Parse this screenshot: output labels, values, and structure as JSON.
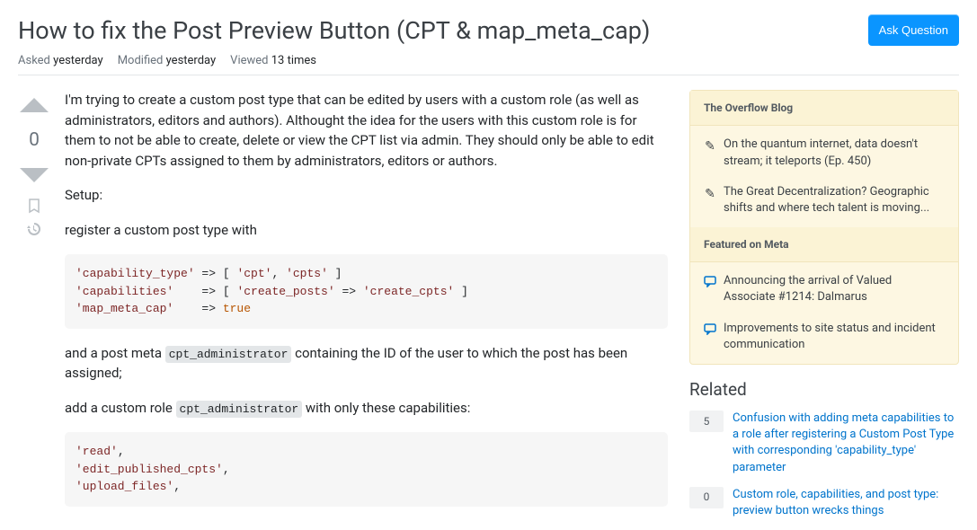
{
  "question": {
    "title": "How to fix the Post Preview Button (CPT & map_meta_cap)",
    "asked_label": "Asked",
    "asked_value": "yesterday",
    "modified_label": "Modified",
    "modified_value": "yesterday",
    "viewed_label": "Viewed",
    "viewed_value": "13 times",
    "vote_count": "0",
    "ask_button": "Ask Question"
  },
  "post": {
    "p1": "I'm trying to create a custom post type that can be edited by users with a custom role (as well as administrators, editors and authors). Althought the idea for the users with this custom role is for them to not be able to create, delete or view the CPT list via admin. They should only be able to edit non-private CPTs assigned to them by administrators, editors or authors.",
    "p2": "Setup:",
    "p3": "register a custom post type with",
    "code1_l1a": "'capability_type'",
    "code1_l1b": " => [ ",
    "code1_l1c": "'cpt'",
    "code1_l1d": ", ",
    "code1_l1e": "'cpts'",
    "code1_l1f": " ]",
    "code1_l2a": "'capabilities'",
    "code1_l2b": "    => [ ",
    "code1_l2c": "'create_posts'",
    "code1_l2d": " => ",
    "code1_l2e": "'create_cpts'",
    "code1_l2f": " ]",
    "code1_l3a": "'map_meta_cap'",
    "code1_l3b": "    => ",
    "code1_l3c": "true",
    "p4a": "and a post meta ",
    "p4code": "cpt_administrator",
    "p4b": " containing the ID of the user to which the post has been assigned;",
    "p5a": "add a custom role ",
    "p5code": "cpt_administrator",
    "p5b": " with only these capabilities:",
    "code2_l1": "'read'",
    "code2_l1p": ",",
    "code2_l2": "'edit_published_cpts'",
    "code2_l2p": ",",
    "code2_l3": "'upload_files'",
    "code2_l3p": ","
  },
  "bulletin": {
    "blog_hdr": "The Overflow Blog",
    "blog1": "On the quantum internet, data doesn't stream; it teleports (Ep. 450)",
    "blog2": "The Great Decentralization? Geographic shifts and where tech talent is moving...",
    "meta_hdr": "Featured on Meta",
    "meta1": "Announcing the arrival of Valued Associate #1214: Dalmarus",
    "meta2": "Improvements to site status and incident communication"
  },
  "related": {
    "hdr": "Related",
    "items": [
      {
        "count": "5",
        "title": "Confusion with adding meta capabilities to a role after registering a Custom Post Type with corresponding 'capability_type' parameter"
      },
      {
        "count": "0",
        "title": "Custom role, capabilities, and post type: preview button wrecks things"
      }
    ]
  }
}
